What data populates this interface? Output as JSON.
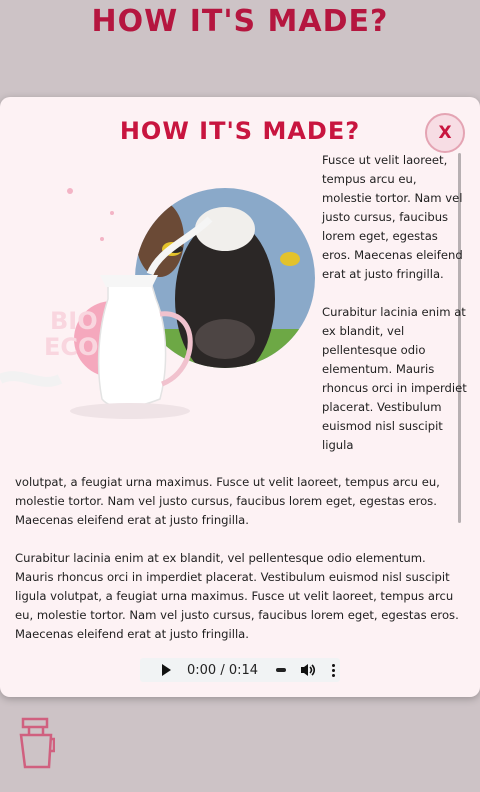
{
  "page": {
    "title": "HOW IT'S MADE?"
  },
  "modal": {
    "title": "HOW IT'S MADE?",
    "close_label": "X",
    "side_paragraphs": [
      "Fusce ut velit laoreet, tempus arcu eu, molestie tortor. Nam vel justo cursus, faucibus lorem eget, egestas eros. Maecenas eleifend erat at justo fringilla.",
      "Curabitur lacinia enim at ex blandit, vel pellentesque odio elementum. Mauris rhoncus orci in imperdiet placerat. Vestibulum euismod nisl suscipit ligula"
    ],
    "full_paragraphs": [
      "volutpat, a feugiat urna maximus. Fusce ut velit laoreet, tempus arcu eu, molestie tortor. Nam vel justo cursus, faucibus lorem eget, egestas eros. Maecenas eleifend erat at justo fringilla.",
      "Curabitur lacinia enim at ex blandit, vel pellentesque odio elementum. Mauris rhoncus orci in imperdiet placerat. Vestibulum euismod nisl suscipit ligula volutpat, a feugiat urna maximus. Fusce ut velit laoreet, tempus arcu eu, molestie tortor. Nam vel justo cursus, faucibus lorem eget, egestas eros. Maecenas eleifend erat at justo fringilla."
    ],
    "image_badge_text": "BIO ECO"
  },
  "audio": {
    "time": "0:00 / 0:14",
    "play_icon": "play-icon",
    "volume_icon": "volume-icon",
    "more_icon": "more-vert-icon"
  },
  "bottom": {
    "icon": "milk-cup-icon"
  },
  "colors": {
    "accent": "#c8153f",
    "title": "#b5163f",
    "background": "#cdc3c6",
    "modal_bg": "#fdf2f4"
  }
}
